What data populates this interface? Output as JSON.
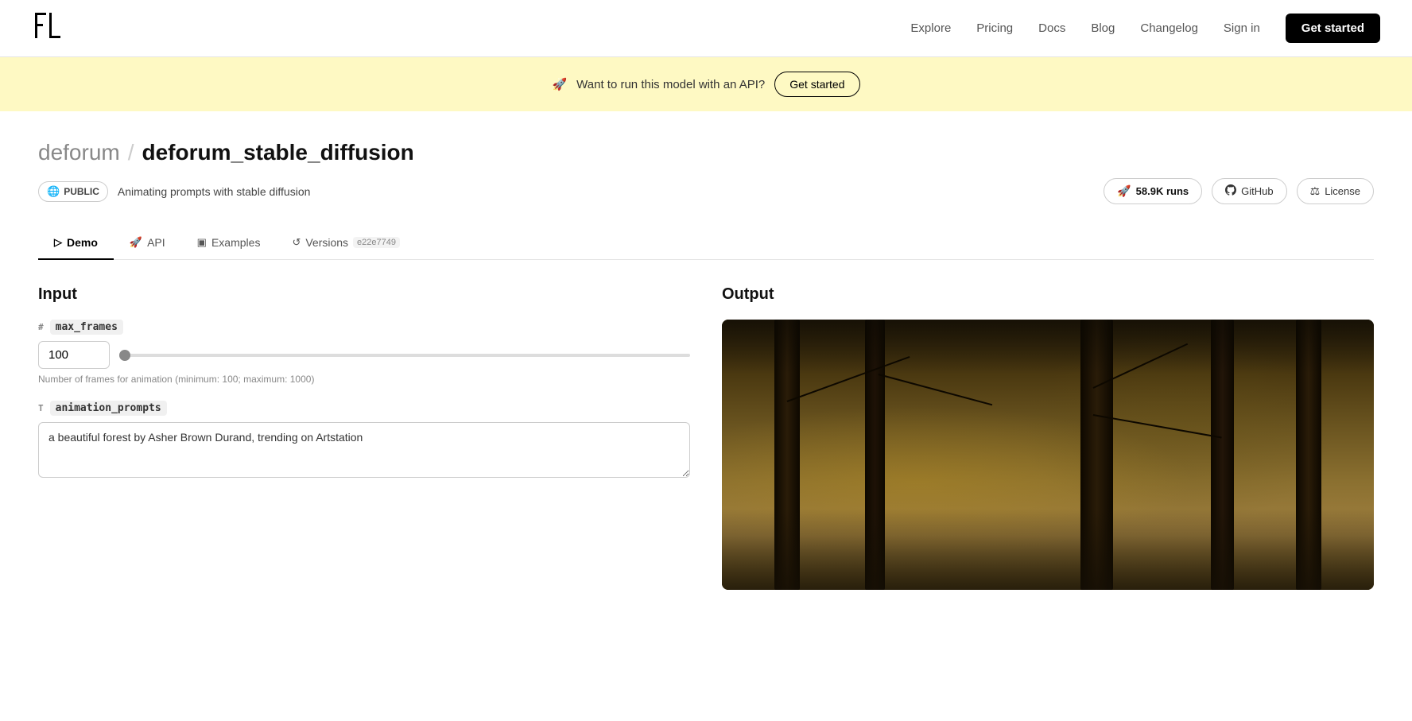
{
  "navbar": {
    "logo_text": "▛▀",
    "links": [
      {
        "label": "Explore",
        "href": "#"
      },
      {
        "label": "Pricing",
        "href": "#"
      },
      {
        "label": "Docs",
        "href": "#"
      },
      {
        "label": "Blog",
        "href": "#"
      },
      {
        "label": "Changelog",
        "href": "#"
      },
      {
        "label": "Sign in",
        "href": "#"
      }
    ],
    "cta_label": "Get started"
  },
  "banner": {
    "emoji": "🚀",
    "text": "Want to run this model with an API?",
    "cta_label": "Get started"
  },
  "model": {
    "namespace": "deforum",
    "slash": "/",
    "name": "deforum_stable_diffusion",
    "visibility": "PUBLIC",
    "description": "Animating prompts with stable diffusion",
    "runs_count": "58.9K runs",
    "github_label": "GitHub",
    "license_label": "License"
  },
  "tabs": [
    {
      "label": "Demo",
      "icon": "▷",
      "active": true
    },
    {
      "label": "API",
      "icon": "🚀"
    },
    {
      "label": "Examples",
      "icon": "▣"
    },
    {
      "label": "Versions",
      "icon": "↺",
      "version": "e22e7749"
    }
  ],
  "input": {
    "title": "Input",
    "fields": [
      {
        "type": "#",
        "name": "max_frames",
        "value": "100",
        "hint": "Number of frames for animation (minimum: 100; maximum: 1000)",
        "slider_min": 100,
        "slider_max": 1000,
        "slider_value": 100,
        "kind": "number"
      },
      {
        "type": "T",
        "name": "animation_prompts",
        "value": "a beautiful forest by Asher Brown Durand, trending on Artstation",
        "kind": "textarea"
      }
    ]
  },
  "output": {
    "title": "Output"
  }
}
